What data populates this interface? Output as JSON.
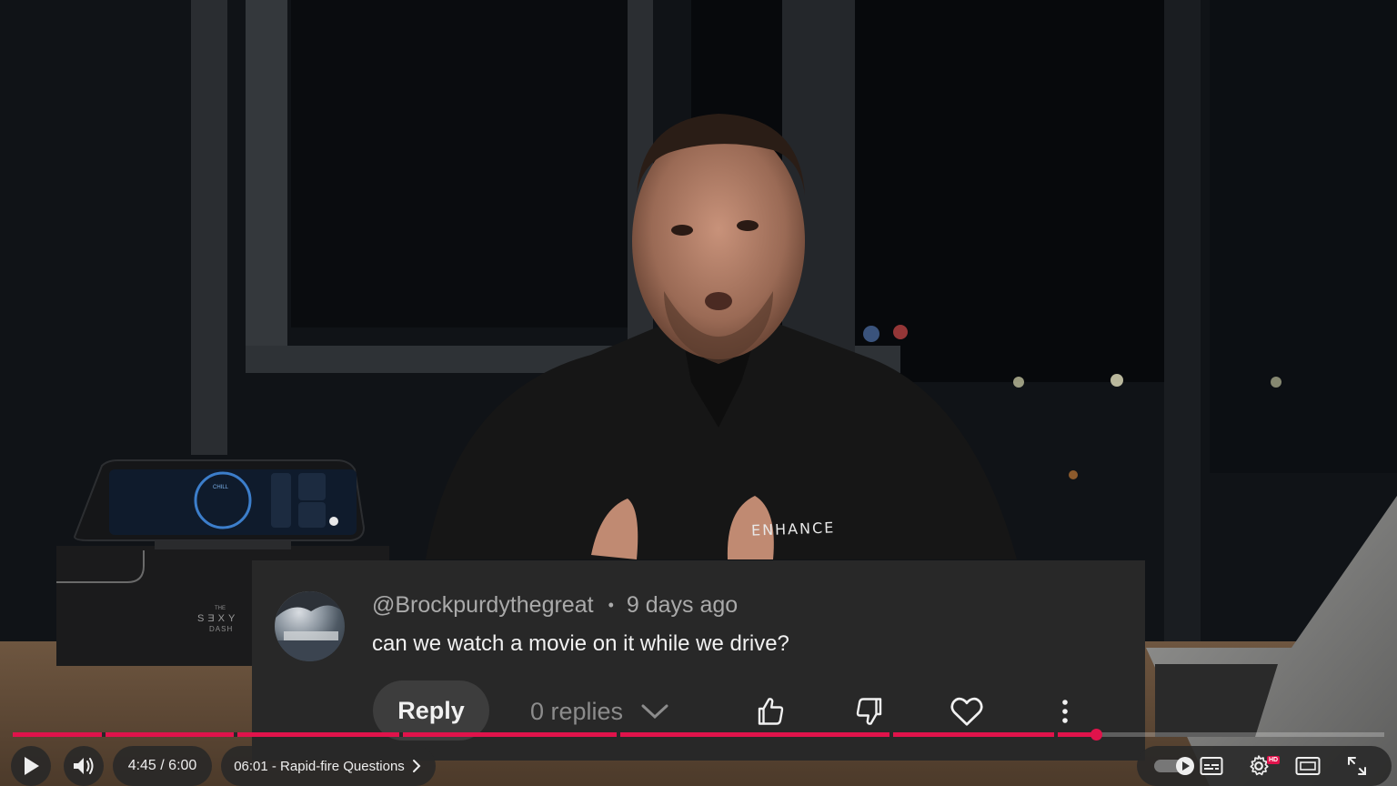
{
  "comment": {
    "author": "@Brockpurdythegreat",
    "separator": "•",
    "time_ago": "9 days ago",
    "text": "can we watch a movie on it while we drive?",
    "reply_label": "Reply",
    "replies_label": "0 replies"
  },
  "scene": {
    "shirt_logo": "ENHANCE",
    "box_text_top": "THE",
    "box_text_main": "SƎXY",
    "box_text_sub": "DASH",
    "dash_mode": "CHILL"
  },
  "player": {
    "time_display": "4:45 / 6:00",
    "chapter_label": "06:01 - Rapid-fire Questions",
    "progress_fraction": 0.79,
    "hd_badge": "HD",
    "accent_color": "#e0134b"
  },
  "icons": {
    "play": "play-icon",
    "volume": "volume-icon",
    "chevron": "chevron-right-icon",
    "like": "thumbs-up-icon",
    "dislike": "thumbs-down-icon",
    "heart": "heart-icon",
    "more": "more-vertical-icon",
    "autoplay": "autoplay-toggle-icon",
    "captions": "captions-icon",
    "settings": "settings-gear-icon",
    "theater": "theater-mode-icon",
    "fullscreen": "fullscreen-icon"
  }
}
